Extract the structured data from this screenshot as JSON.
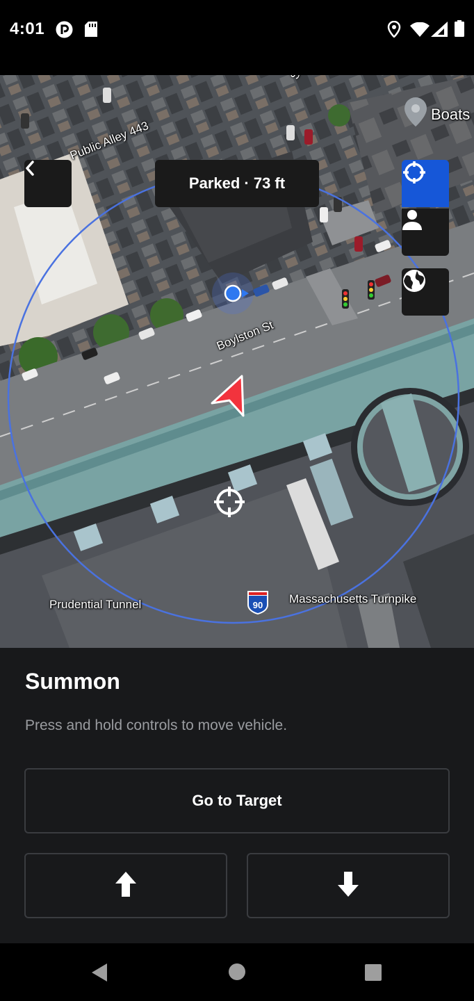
{
  "status_bar": {
    "time": "4:01",
    "icons": [
      "pocketcasts-icon",
      "sd-card-icon",
      "location-icon",
      "wifi-icon",
      "signal-icon",
      "battery-icon"
    ]
  },
  "map": {
    "vehicle_status": "Parked · 73 ft",
    "labels": {
      "alley": "Public Alley 443",
      "street1": "Boylston St",
      "tunnel": "Prudential Tunnel",
      "turnpike": "Massachusetts Turnpike",
      "poi": "Boats",
      "route_shield": "90",
      "street_top": "St"
    },
    "controls": {
      "back": "back-icon",
      "recenter": "crosshair-icon",
      "person": "person-icon",
      "globe": "globe-icon"
    },
    "colors": {
      "active_button": "#1657d8",
      "range_circle": "#3f6ee0",
      "vehicle_arrow": "#f2333d"
    }
  },
  "sheet": {
    "title": "Summon",
    "subtitle": "Press and hold controls to move vehicle.",
    "go_to_target": "Go to Target",
    "forward_icon": "arrow-up-icon",
    "reverse_icon": "arrow-down-icon"
  },
  "nav_bar": {
    "buttons": [
      "back-triangle-icon",
      "home-circle-icon",
      "recents-square-icon"
    ]
  }
}
